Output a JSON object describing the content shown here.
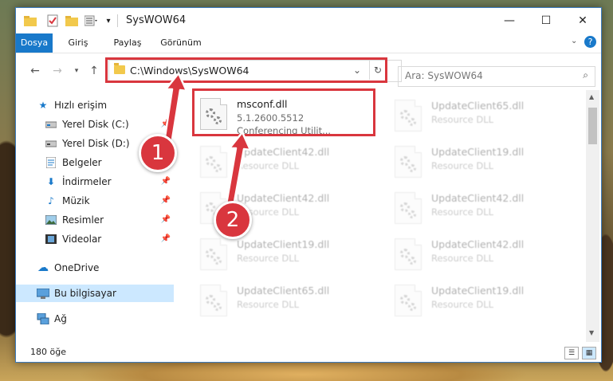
{
  "window": {
    "title": "SysWOW64"
  },
  "ribbon": {
    "tabs": [
      "Dosya",
      "Giriş",
      "Paylaş",
      "Görünüm"
    ]
  },
  "address": {
    "path": "C:\\Windows\\SysWOW64"
  },
  "search": {
    "placeholder": "Ara: SysWOW64"
  },
  "nav": [
    {
      "label": "Hızlı erişim",
      "icon": "star-icon"
    },
    {
      "label": "Yerel Disk (C:)",
      "icon": "drive-icon",
      "pinned": true
    },
    {
      "label": "Yerel Disk (D:)",
      "icon": "drive-icon",
      "pinned": true
    },
    {
      "label": "Belgeler",
      "icon": "document-icon",
      "pinned": true
    },
    {
      "label": "İndirmeler",
      "icon": "download-icon",
      "pinned": true
    },
    {
      "label": "Müzik",
      "icon": "music-icon",
      "pinned": true
    },
    {
      "label": "Resimler",
      "icon": "picture-icon",
      "pinned": true
    },
    {
      "label": "Videolar",
      "icon": "video-icon",
      "pinned": true
    },
    {
      "label": "OneDrive",
      "icon": "cloud-icon"
    },
    {
      "label": "Bu bilgisayar",
      "icon": "computer-icon",
      "selected": true
    },
    {
      "label": "Ağ",
      "icon": "network-icon"
    }
  ],
  "files": {
    "main": {
      "name": "msconf.dll",
      "version": "5.1.2600.5512",
      "desc": "Conferencing Utilit..."
    },
    "right": [
      {
        "name": "UpdateClient65.dll",
        "desc": "Resource DLL"
      },
      {
        "name": "UpdateClient19.dll",
        "desc": "Resource DLL"
      },
      {
        "name": "UpdateClient42.dll",
        "desc": "Resource DLL"
      },
      {
        "name": "UpdateClient42.dll",
        "desc": "Resource DLL"
      },
      {
        "name": "UpdateClient19.dll",
        "desc": "Resource DLL"
      }
    ],
    "left": [
      {
        "name": "UpdateClient42.dll",
        "desc": "Resource DLL"
      },
      {
        "name": "UpdateClient42.dll",
        "desc": "Resource DLL"
      },
      {
        "name": "UpdateClient19.dll",
        "desc": "Resource DLL"
      },
      {
        "name": "UpdateClient65.dll",
        "desc": "Resource DLL"
      }
    ]
  },
  "status": {
    "count": "180 öğe"
  },
  "annotations": {
    "badge1": "1",
    "badge2": "2",
    "color": "#d9363e"
  }
}
